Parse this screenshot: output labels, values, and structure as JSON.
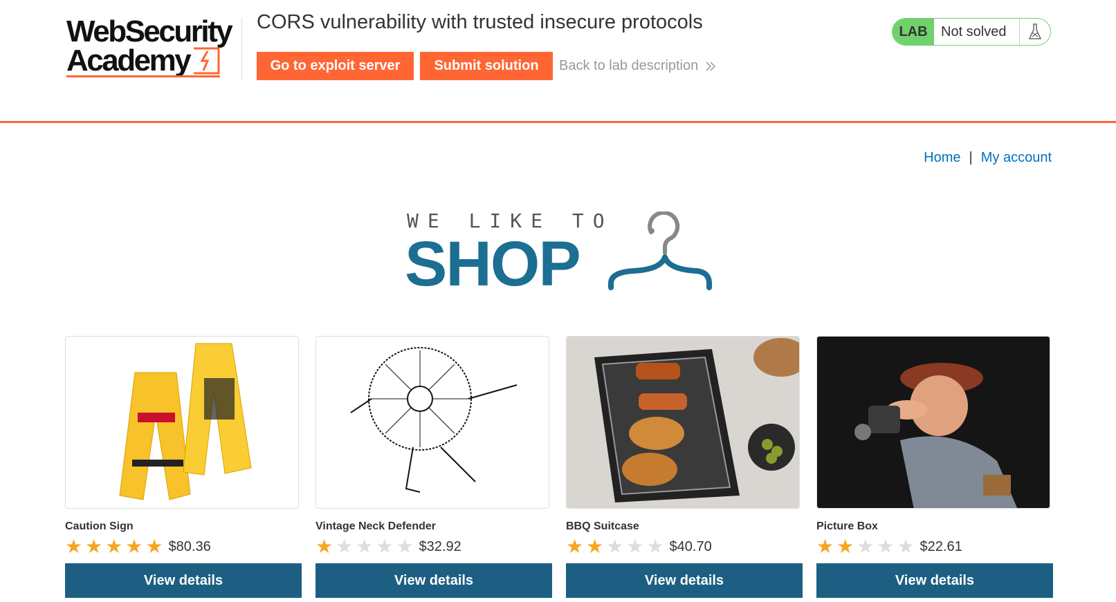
{
  "logo": {
    "line1": "WebSecurity",
    "line2": "Academy"
  },
  "lab": {
    "title": "CORS vulnerability with trusted insecure protocols",
    "exploit_button": "Go to exploit server",
    "submit_button": "Submit solution",
    "back_link": "Back to lab description",
    "badge": "LAB",
    "status": "Not solved"
  },
  "nav": {
    "home": "Home",
    "separator": "|",
    "account": "My account"
  },
  "banner": {
    "small": "WE LIKE TO",
    "big": "SHOP"
  },
  "colors": {
    "accent": "#ff6633",
    "brand_blue": "#1c6e92",
    "button_blue": "#1c5f82",
    "link": "#0071bc",
    "lab_green": "#70d16d",
    "star": "#f5a623"
  },
  "products": [
    {
      "name": "Caution Sign",
      "rating": 5,
      "price": "$80.36",
      "button": "View details"
    },
    {
      "name": "Vintage Neck Defender",
      "rating": 1,
      "price": "$32.92",
      "button": "View details"
    },
    {
      "name": "BBQ Suitcase",
      "rating": 2,
      "price": "$40.70",
      "button": "View details"
    },
    {
      "name": "Picture Box",
      "rating": 2,
      "price": "$22.61",
      "button": "View details"
    }
  ]
}
